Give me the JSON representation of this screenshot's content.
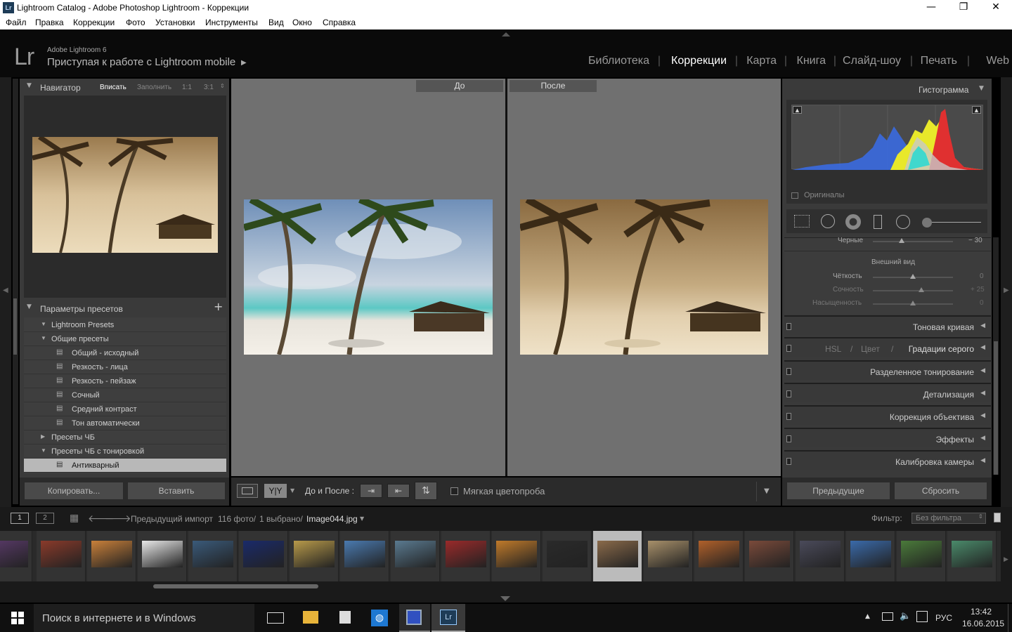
{
  "window": {
    "title": "Lightroom Catalog - Adobe Photoshop Lightroom - Коррекции",
    "app_icon": "Lr",
    "minimize": "—",
    "maximize": "❐",
    "close": "✕"
  },
  "menu": [
    "Файл",
    "Правка",
    "Коррекции",
    "Фото",
    "Установки",
    "Инструменты",
    "Вид",
    "Окно",
    "Справка"
  ],
  "header": {
    "logo": "Lr",
    "version": "Adobe Lightroom 6",
    "mobile": "Приступая к работе с Lightroom mobile"
  },
  "modules": [
    "Библиотека",
    "Коррекции",
    "Карта",
    "Книга",
    "Слайд-шоу",
    "Печать",
    "Web"
  ],
  "active_module": "Коррекции",
  "navigator": {
    "title": "Навигатор",
    "options": [
      "Вписать",
      "Заполнить",
      "1:1",
      "3:1"
    ]
  },
  "presets": {
    "title": "Параметры пресетов",
    "add": "+",
    "items": [
      {
        "label": "Lightroom Presets",
        "level": 0,
        "expanded": true
      },
      {
        "label": "Общие пресеты",
        "level": 0,
        "expanded": true
      },
      {
        "label": "Общий - исходный",
        "level": 1
      },
      {
        "label": "Резкость - лица",
        "level": 1
      },
      {
        "label": "Резкость - пейзаж",
        "level": 1
      },
      {
        "label": "Сочный",
        "level": 1
      },
      {
        "label": "Средний контраст",
        "level": 1
      },
      {
        "label": "Тон автоматически",
        "level": 1
      },
      {
        "label": "Пресеты ЧБ",
        "level": 0,
        "expanded": false
      },
      {
        "label": "Пресеты ЧБ с тонировкой",
        "level": 0,
        "expanded": true
      },
      {
        "label": "Антикварный",
        "level": 1,
        "selected": true
      }
    ]
  },
  "left_buttons": {
    "copy": "Копировать...",
    "paste": "Вставить"
  },
  "compare": {
    "before": "До",
    "after": "После"
  },
  "toolbar": {
    "before_after_label": "До и После :",
    "soft_proof": "Мягкая цветопроба",
    "yy": "Y|Y"
  },
  "right": {
    "histogram_title": "Гистограмма",
    "originals": "Оригиналы",
    "blacks_label": "Черные",
    "blacks_value": "− 30",
    "presence_title": "Внешний вид",
    "presence": [
      {
        "label": "Чёткость",
        "value": "0",
        "pos": 0.5
      },
      {
        "label": "Сочность",
        "value": "+ 25",
        "pos": 0.62
      },
      {
        "label": "Насыщенность",
        "value": "0",
        "pos": 0.5
      }
    ],
    "sections": [
      "Тоновая кривая",
      "Разделенное тонирование",
      "Детализация",
      "Коррекция объектива",
      "Эффекты",
      "Калибровка камеры"
    ],
    "hsl": [
      "HSL",
      "/",
      "Цвет",
      "/",
      "Градации серого"
    ],
    "prev_button": "Предыдущие",
    "reset_button": "Сбросить"
  },
  "filmbar": {
    "page1": "1",
    "page2": "2",
    "source": "Предыдущий импорт",
    "count": "116 фото/",
    "selected": "1 выбрано/",
    "file": "Image044.jpg",
    "filter_label": "Фильтр:",
    "filter_value": "Без фильтра"
  },
  "thumb_colors": [
    "#5a3a6a",
    "#8a3a2a",
    "#c9803a",
    "#e8e8e8",
    "#3a5a7a",
    "#1a2a6a",
    "#b89a4a",
    "#4a7ab0",
    "#5a7a90",
    "#9a2a2a",
    "#c07a2a",
    "#2a2a2a",
    "#8a6a4a",
    "#a8906a",
    "#b0602a",
    "#7a4a3a",
    "#4a4a5a",
    "#3a6aaa",
    "#4a7a3a",
    "#4a8a6a"
  ],
  "taskbar": {
    "search": "Поиск в интернете и в Windows",
    "lang": "РУС",
    "time": "13:42",
    "date": "16.06.2015"
  }
}
